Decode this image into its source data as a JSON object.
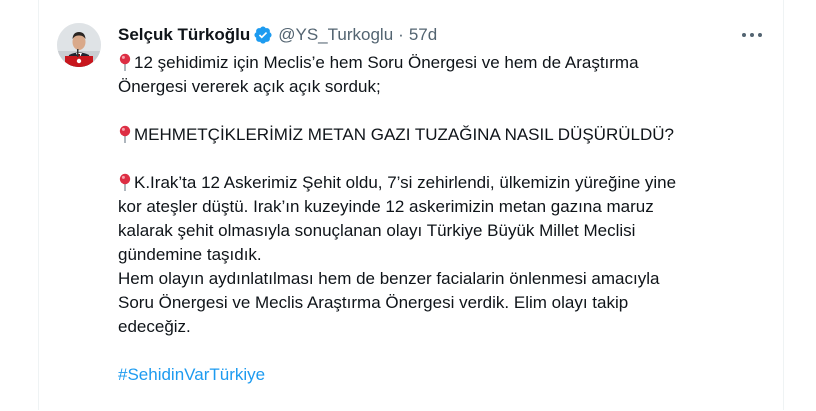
{
  "author": {
    "display_name": "Selçuk Türkoğlu",
    "handle": "@YS_Turkoglu",
    "separator": "·",
    "timestamp": "57d",
    "verified_color": "#1d9bf0"
  },
  "menu": {
    "more_icon": "more-horizontal-icon"
  },
  "tweet": {
    "p1": {
      "line1": "12 şehidimiz için Meclis’e hem Soru Önergesi ve hem de Araştırma",
      "line2": "Önergesi vererek açık açık sorduk;"
    },
    "p2": {
      "line1": "MEHMETÇİKLERİMİZ METAN GAZI TUZAĞINA NASIL DÜŞÜRÜLDÜ?"
    },
    "p3": {
      "line1": "K.Irak’ta 12 Askerimiz Şehit oldu, 7’si zehirlendi, ülkemizin yüreğine yine",
      "line2": "kor ateşler düştü. Irak’ın kuzeyinde 12 askerimizin metan gazına maruz",
      "line3": "kalarak şehit olmasıyla sonuçlanan olayı Türkiye Büyük Millet Meclisi",
      "line4": "gündemine taşıdık.",
      "line5": "Hem olayın aydınlatılması hem de benzer facialarin önlenmesi amacıyla",
      "line6": "Soru Önergesi ve Meclis Araştırma Önergesi verdik. Elim olayı takip",
      "line7": "edeceğiz."
    },
    "hashtag": "#SehidinVarTürkiye",
    "pin_icon": "round-pushpin-icon",
    "accent_color": "#1d9bf0",
    "text_color": "#0f1419",
    "muted_color": "#536471"
  }
}
